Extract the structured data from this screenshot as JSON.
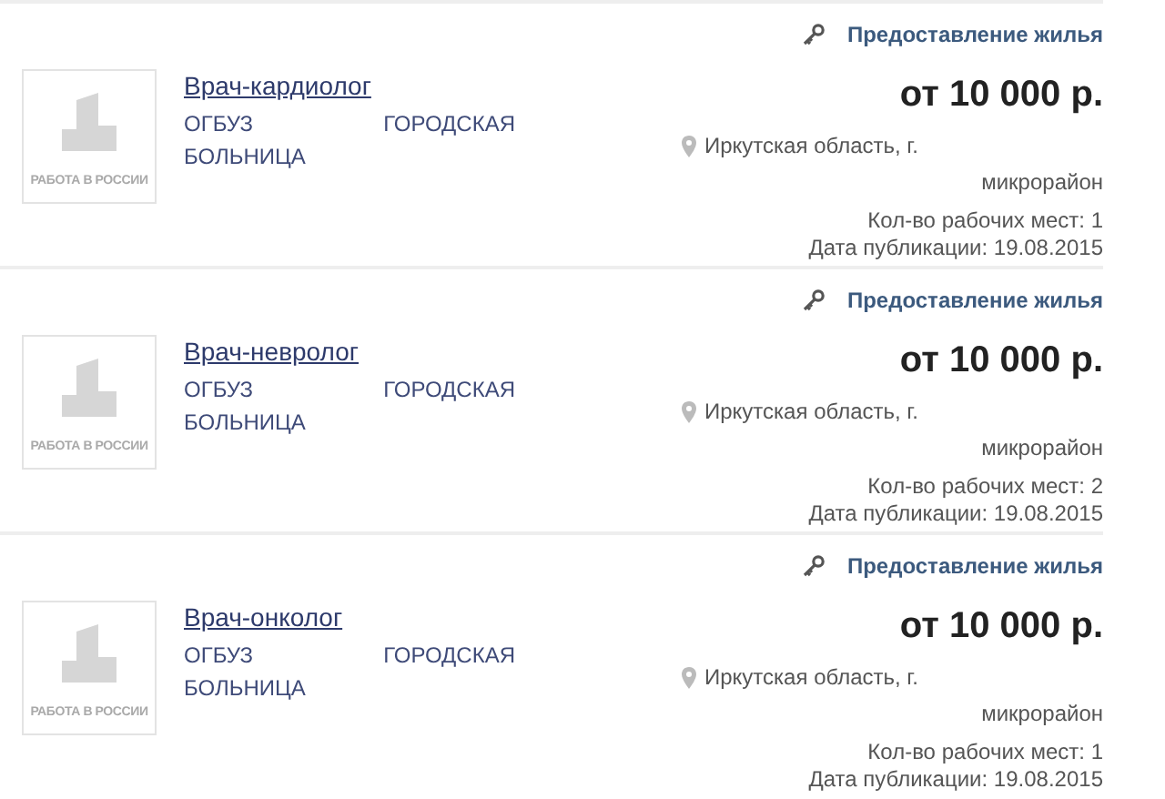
{
  "vacancies": [
    {
      "logo_text": "РАБОТА В РОССИИ",
      "title": "Врач-кардиолог",
      "employer": "ОГБУЗ ГОРОДСКАЯ БОЛЬНИЦА",
      "feature": "Предоставление жилья",
      "salary": "от 10 000 р.",
      "location": [
        "Иркутская область, г.",
        "микрорайон"
      ],
      "positions": "Кол-во рабочих мест: 1",
      "published": "Дата публикации: 19.08.2015"
    },
    {
      "logo_text": "РАБОТА В РОССИИ",
      "title": "Врач-невролог",
      "employer": "ОГБУЗ ГОРОДСКАЯ БОЛЬНИЦА",
      "feature": "Предоставление жилья",
      "salary": "от 10 000 р.",
      "location": [
        "Иркутская область, г.",
        "микрорайон"
      ],
      "positions": "Кол-во рабочих мест: 2",
      "published": "Дата публикации: 19.08.2015"
    },
    {
      "logo_text": "РАБОТА В РОССИИ",
      "title": "Врач-онколог",
      "employer": "ОГБУЗ ГОРОДСКАЯ БОЛЬНИЦА",
      "feature": "Предоставление жилья",
      "salary": "от 10 000 р.",
      "location": [
        "Иркутская область, г.",
        "микрорайон"
      ],
      "positions": "Кол-во рабочих мест: 1",
      "published": "Дата публикации: 19.08.2015"
    }
  ]
}
